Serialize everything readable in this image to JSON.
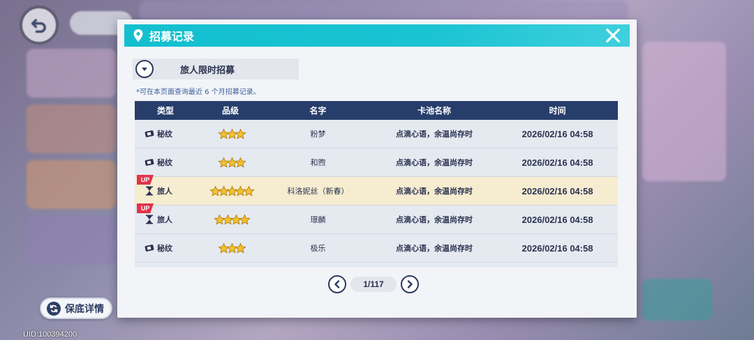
{
  "background": {
    "uid": "UID:100394200"
  },
  "guarantee_button": {
    "label": "保底详情"
  },
  "modal": {
    "title": "招募记录",
    "dropdown": {
      "selected": "旅人限时招募"
    },
    "note": "*可在本页面查询最近 6 个月招募记录。",
    "table": {
      "headers": [
        "类型",
        "品级",
        "名字",
        "卡池名称",
        "时间"
      ],
      "rows": [
        {
          "type": "秘纹",
          "type_icon": "ticket-icon",
          "stars": 3,
          "name": "粉梦",
          "pool": "点滴心语，余温尚存时",
          "time": "2026/02/16 04:58",
          "up": false,
          "highlight": false
        },
        {
          "type": "秘纹",
          "type_icon": "ticket-icon",
          "stars": 3,
          "name": "和煦",
          "pool": "点滴心语，余温尚存时",
          "time": "2026/02/16 04:58",
          "up": false,
          "highlight": false
        },
        {
          "type": "旅人",
          "type_icon": "traveler-icon",
          "stars": 5,
          "name": "科洛妮丝（新春）",
          "pool": "点滴心语，余温尚存时",
          "time": "2026/02/16 04:58",
          "up": true,
          "highlight": true
        },
        {
          "type": "旅人",
          "type_icon": "traveler-icon",
          "stars": 4,
          "name": "璟麟",
          "pool": "点滴心语，余温尚存时",
          "time": "2026/02/16 04:58",
          "up": true,
          "highlight": false
        },
        {
          "type": "秘纹",
          "type_icon": "ticket-icon",
          "stars": 3,
          "name": "极乐",
          "pool": "点滴心语，余温尚存时",
          "time": "2026/02/16 04:58",
          "up": false,
          "highlight": false
        }
      ]
    },
    "pager": {
      "label": "1/117"
    },
    "up_badge": "UP"
  },
  "colors": {
    "header_teal": "#1ac3d2",
    "table_header": "#273e6b",
    "highlight_row": "#f6ecd0",
    "star_gold": "#f2c12e",
    "up_red": "#e0334a"
  }
}
